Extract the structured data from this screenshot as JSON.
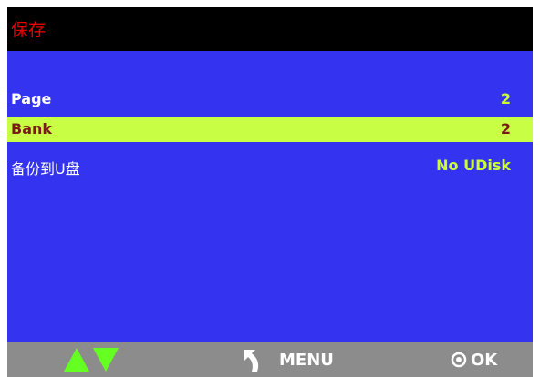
{
  "header": {
    "title": "保存"
  },
  "menu": {
    "items": [
      {
        "label": "Page",
        "value": "2"
      },
      {
        "label": "Bank",
        "value": "2"
      },
      {
        "label": "备份到U盘",
        "value": "No UDisk"
      }
    ]
  },
  "footer": {
    "nav_icons": [
      "up-arrow-icon",
      "down-arrow-icon"
    ],
    "back_icon": "back-arrow-icon",
    "menu_label": "MENU",
    "ok_icon": "ok-circle-icon",
    "ok_label": "OK"
  },
  "colors": {
    "title_bar": "#000000",
    "title_text": "#e60000",
    "background": "#3333f0",
    "highlight": "#c8ff44",
    "value_text": "#ccff33",
    "footer": "#8c8c8c",
    "arrows": "#66ff22"
  }
}
